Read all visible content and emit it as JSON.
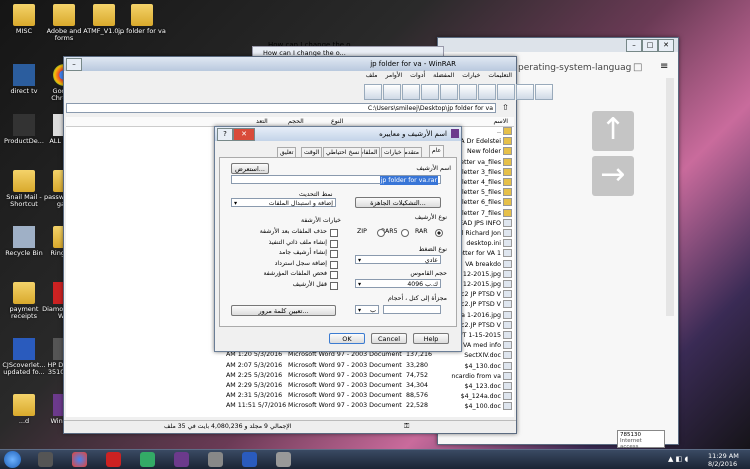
{
  "desktop_icons": [
    {
      "label": "MISC",
      "icon": "folder-icon"
    },
    {
      "label": "Adobe and forms",
      "icon": "folder-icon"
    },
    {
      "label": "ATMF_V1.0...",
      "icon": "folder-icon"
    },
    {
      "label": "jp folder for va",
      "icon": "folder-icon"
    },
    {
      "label": "direct tv",
      "icon": "monitor-icon"
    },
    {
      "label": "Google Chrome",
      "icon": "chrome-icon"
    },
    {
      "label": "ProductDe...",
      "icon": "toolbox-icon"
    },
    {
      "label": "ALL GA...",
      "icon": "calendar-icon"
    },
    {
      "label": "Snail Mail - Shortcut",
      "icon": "folder-icon"
    },
    {
      "label": "passw... and ga...",
      "icon": "folder-icon"
    },
    {
      "label": "Recycle Bin",
      "icon": "recycle-bin-icon"
    },
    {
      "label": "Ringto...",
      "icon": "folder-icon"
    },
    {
      "label": "payment receipts",
      "icon": "folder-icon"
    },
    {
      "label": "Diamo... 10.6 W...",
      "icon": "app-icon"
    },
    {
      "label": "CJScoverlet... updated fo...",
      "icon": "word-doc-icon"
    },
    {
      "label": "HP Desk... 3510 se...",
      "icon": "printer-icon"
    },
    {
      "label": "...d",
      "icon": "folder-icon"
    },
    {
      "label": "WinRA...",
      "icon": "winrar-icon"
    }
  ],
  "chrome_tab": {
    "title": "How can I change the o...",
    "url_fragment": "perating-system-languag"
  },
  "winrar": {
    "title": "jp folder for va - WinRAR",
    "menu": [
      "ملف",
      "الأوامر",
      "أدوات",
      "المفضلة",
      "خيارات",
      "التعليمات"
    ],
    "path": "C:\\Users\\smileej\\Desktop\\jp folder for va",
    "columns": [
      "الاسم",
      "الحجم",
      "النوع"
    ],
    "col_left": "التعد",
    "files_right": [
      "..",
      "JP VA Dr Edelstei",
      "New folder",
      "Letter va_files",
      "letter 3_files",
      "letter 4_files",
      "letter 5_files",
      "letter 6_files",
      "letter 7_files",
      "READ JPS INFO",
      "bul Richard Jon",
      "desktop.ini",
      "etter for VA 1",
      "VA breakdo",
      "d 12-2015.jpg",
      "d 12-2015.jpg",
      "Doc2 JP PTSD V",
      "Doc2.JP PTSD V",
      "va 1-2016.jpg",
      "Doc2.JP PTSD V",
      "or PT 1-15-2015",
      "VA med info",
      "SectXIV.doc",
      "$4_130.doc",
      "ncardio from va",
      "$4_123.doc",
      "$4_124a.doc",
      "$4_100.doc"
    ],
    "rows": [
      {
        "date": "PM 2:33 4/16/2016",
        "type": "Text Document",
        "size": "803,215",
        "name": "va med info"
      },
      {
        "date": "AM 1:20 5/3/2016",
        "type": "Microsoft Word 97 - 2003 Document",
        "size": "137,216",
        "name": "SectXIV.doc"
      },
      {
        "date": "AM 2:07 5/3/2016",
        "type": "Microsoft Word 97 - 2003 Document",
        "size": "33,280",
        "name": "$4_130.doc"
      },
      {
        "date": "AM 2:25 5/3/2016",
        "type": "Microsoft Word 97 - 2003 Document",
        "size": "74,752",
        "name": "ncardio from va"
      },
      {
        "date": "AM 2:29 5/3/2016",
        "type": "Microsoft Word 97 - 2003 Document",
        "size": "34,304",
        "name": "$4_123.doc"
      },
      {
        "date": "AM 2:31 5/3/2016",
        "type": "Microsoft Word 97 - 2003 Document",
        "size": "88,576",
        "name": "$4_124a.doc"
      },
      {
        "date": "AM 11:51 5/7/2016",
        "type": "Microsoft Word 97 - 2003 Document",
        "size": "22,528",
        "name": "$4_100.doc"
      }
    ],
    "status": "الإجمالي 9 مجلد و 4,080,236 بايت في 35 ملف"
  },
  "dialog": {
    "title": "اسم الأرشيف و معاييره",
    "tabs": [
      "عام",
      "متقدم",
      "خيارات",
      "الملفات",
      "نسخ احتياطي",
      "الوقت",
      "تعليق"
    ],
    "archive_name_label": "اسم الأرشيف",
    "archive_name": "jp folder for va.rar",
    "browse": "استعرض...",
    "update_label": "نمط التحديث",
    "update_value": "إضافة و استبدال الملفات",
    "profiles": "التشكيلات الجاهزة...",
    "format_label": "نوع الأرشيف",
    "formats": [
      "RAR",
      "RAR5",
      "ZIP"
    ],
    "compression_label": "نوع الضغط",
    "compression_value": "عادي",
    "dict_label": "حجم القاموس",
    "dict_value": "4096 ك.ب",
    "split_label": "مجزأة إلى كتل ، أحجام",
    "split_unit": "ب",
    "options_label": "خيارات الأرشفة",
    "options": [
      "حذف الملفات بعد الأرشفة",
      "إنشاء ملف ذاتي التنفيذ",
      "إنشاء أرشيف جامد",
      "إضافة سجل استرداد",
      "فحص الملفات المؤرشفة",
      "قفل الأرشيف"
    ],
    "password": "تعيين كلمة مرور...",
    "ok": "OK",
    "cancel": "Cancel",
    "help": "Help"
  },
  "popup": {
    "code": "785130",
    "text": "Internet access"
  },
  "taskbar": {
    "time": "11:29 AM",
    "date": "8/2/2016"
  }
}
